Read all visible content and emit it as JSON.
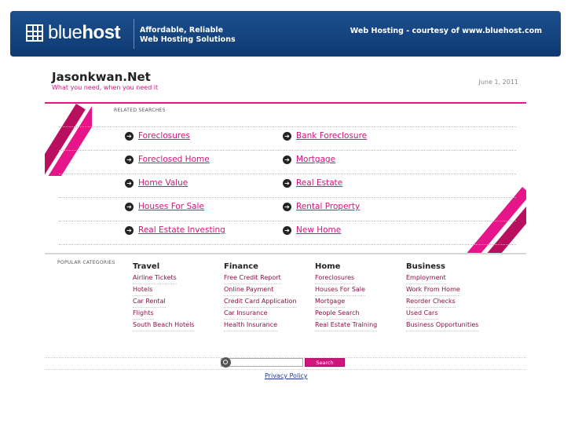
{
  "banner": {
    "logo_light": "blue",
    "logo_bold": "host",
    "tagline_line1": "Affordable, Reliable",
    "tagline_line2": "Web Hosting Solutions",
    "courtesy": "Web Hosting - courtesy of www.bluehost.com"
  },
  "site": {
    "title": "Jasonkwan.Net",
    "subtitle": "What you need, when you need it",
    "date": "June 1, 2011"
  },
  "related": {
    "label": "RELATED SEARCHES",
    "left": [
      "Foreclosures",
      "Foreclosed Home",
      "Home Value",
      "Houses For Sale",
      "Real Estate Investing"
    ],
    "right": [
      "Bank Foreclosure",
      "Mortgage",
      "Real Estate",
      "Rental Property",
      "New Home"
    ]
  },
  "popular": {
    "label": "POPULAR CATEGORIES",
    "categories": [
      {
        "title": "Travel",
        "items": [
          "Airline Tickets",
          "Hotels",
          "Car Rental",
          "Flights",
          "South Beach Hotels"
        ]
      },
      {
        "title": "Finance",
        "items": [
          "Free Credit Report",
          "Online Payment",
          "Credit Card Application",
          "Car Insurance",
          "Health Insurance"
        ]
      },
      {
        "title": "Home",
        "items": [
          "Foreclosures",
          "Houses For Sale",
          "Mortgage",
          "People Search",
          "Real Estate Training"
        ]
      },
      {
        "title": "Business",
        "items": [
          "Employment",
          "Work From Home",
          "Reorder Checks",
          "Used Cars",
          "Business Opportunities"
        ]
      }
    ]
  },
  "search": {
    "placeholder": "",
    "button": "Search"
  },
  "footer": {
    "privacy": "Privacy Policy"
  },
  "colors": {
    "accent": "#e6168a",
    "banner": "#16457f",
    "link": "#d0157d"
  }
}
